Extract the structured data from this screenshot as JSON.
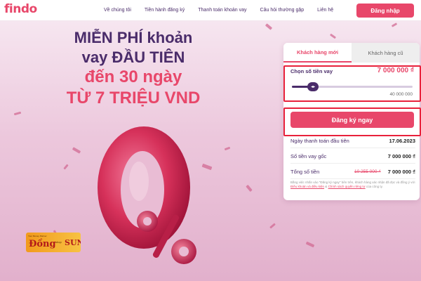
{
  "header": {
    "logo": "findo",
    "nav": [
      "Về chúng tôi",
      "Tiền hành đăng ký",
      "Thanh toán khoản vay",
      "Câu hỏi thường gặp",
      "Liên hệ"
    ],
    "login_label": "Đăng nhập"
  },
  "hero": {
    "line1": "MIỄN PHÍ khoản",
    "line2": "vay ĐẦU TIÊN",
    "line3": "đến 30 ngày",
    "line4": "TỪ 7 TRIỆU VND",
    "big_number": "0",
    "percent": "%"
  },
  "badge": {
    "small": "Your Money Partner",
    "dong": "Đồng",
    "shop": "shop",
    "sun": "SUN"
  },
  "card": {
    "tab_new": "Khách hàng mới",
    "tab_old": "Khách hàng cũ",
    "amount_label": "Chọn số tiền vay",
    "amount_value": "7 000 000 ₫",
    "slider_max": "40 000 000",
    "slider_fraction": 0.175,
    "register_label": "Đăng ký ngay",
    "rows": [
      {
        "key": "Ngày thanh toán đầu tiên",
        "value": "17.06.2023"
      },
      {
        "key": "Số tiền vay gốc",
        "value": "7 000 000 ₫"
      },
      {
        "key": "Tổng số tiền",
        "old": "10 255 000 ₫",
        "value": "7 000 000 ₫"
      }
    ],
    "disclaimer_pre": "Bằng việc nhấn vào \"Đăng ký ngay\" bên trên, khách hàng xác nhận đã đọc và đồng ý với ",
    "disclaimer_link1": "Điều khoản và điều kiện",
    "disclaimer_mid": " & ",
    "disclaimer_link2": "Chính sách quyền riêng tư",
    "disclaimer_post": " của công ty."
  },
  "colors": {
    "brand": "#e8476a",
    "text_dark": "#4a2c6a",
    "highlight": "#e8213b"
  }
}
